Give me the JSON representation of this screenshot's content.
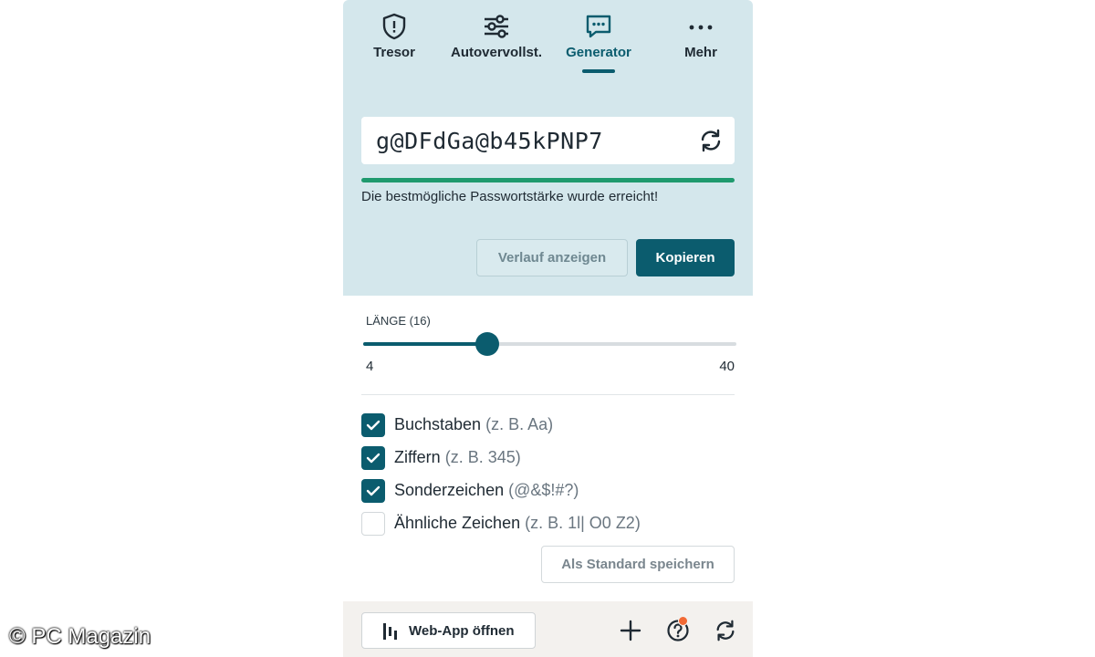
{
  "nav": {
    "tabs": [
      {
        "label": "Tresor",
        "icon": "shield-icon"
      },
      {
        "label": "Autovervollst.",
        "icon": "sliders-icon"
      },
      {
        "label": "Generator",
        "icon": "chat-icon",
        "active": true
      },
      {
        "label": "Mehr",
        "icon": "more-icon"
      }
    ]
  },
  "generator": {
    "password": "g@DFdGa@b45kPNP7",
    "strength_fraction": 1.0,
    "strength_message": "Die bestmögliche Passwortstärke wurde erreicht!",
    "history_label": "Verlauf anzeigen",
    "copy_label": "Kopieren"
  },
  "length": {
    "label": "LÄNGE (16)",
    "value": 16,
    "min": 4,
    "max": 40,
    "min_label": "4",
    "max_label": "40"
  },
  "options": [
    {
      "label": "Buchstaben",
      "hint": "(z. B. Aa)",
      "checked": true
    },
    {
      "label": "Ziffern",
      "hint": "(z. B. 345)",
      "checked": true
    },
    {
      "label": "Sonderzeichen",
      "hint": "(@&$!#?)",
      "checked": true
    },
    {
      "label": "Ähnliche Zeichen",
      "hint": "(z. B. 1l| O0 Z2)",
      "checked": false
    }
  ],
  "save_default_label": "Als Standard speichern",
  "footer": {
    "webapp_label": "Web-App öffnen",
    "icons": [
      "plus-icon",
      "help-icon",
      "sync-icon"
    ]
  },
  "watermark": "© PC Magazin",
  "colors": {
    "accent": "#0b5c6e",
    "header_bg": "#d4e7ec",
    "strength": "#1f9a6e",
    "notification": "#f26a35"
  }
}
